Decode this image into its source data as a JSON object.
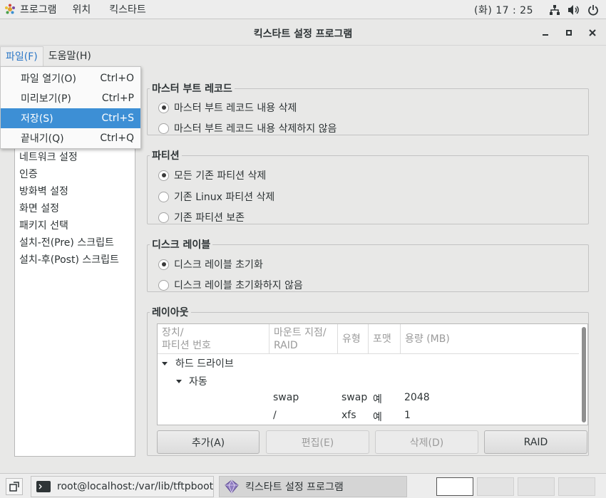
{
  "toppanel": {
    "apps_label": "프로그램",
    "places_label": "위치",
    "app_label": "킥스타트",
    "clock": "(화) 17 : 25"
  },
  "window": {
    "title": "킥스타트 설정 프로그램"
  },
  "menubar": {
    "file": "파일(F)",
    "help": "도움말(H)"
  },
  "file_menu": {
    "items": [
      {
        "label": "파일 열기(O)",
        "shortcut": "Ctrl+O"
      },
      {
        "label": "미리보기(P)",
        "shortcut": "Ctrl+P"
      },
      {
        "label": "저장(S)",
        "shortcut": "Ctrl+S"
      },
      {
        "label": "끝내기(Q)",
        "shortcut": "Ctrl+Q"
      }
    ]
  },
  "sidebar": {
    "items": [
      {
        "label": "네트워크 설정"
      },
      {
        "label": "인증"
      },
      {
        "label": "방화벽 설정"
      },
      {
        "label": "화면 설정"
      },
      {
        "label": "패키지 선택"
      },
      {
        "label": "설치-전(Pre) 스크립트"
      },
      {
        "label": "설치-후(Post) 스크립트"
      }
    ]
  },
  "mbr": {
    "title": "마스터 부트 레코드",
    "options": [
      "마스터 부트 레코드 내용 삭제",
      "마스터 부트 레코드 내용 삭제하지 않음"
    ],
    "selected_index": 0
  },
  "partition": {
    "title": "파티션",
    "options": [
      "모든 기존 파티션 삭제",
      "기존 Linux 파티션 삭제",
      "기존 파티션 보존"
    ],
    "selected_index": 0
  },
  "disklabel": {
    "title": "디스크 레이블",
    "options": [
      "디스크 레이블 초기화",
      "디스크 레이블 초기화하지 않음"
    ],
    "selected_index": 0
  },
  "layout": {
    "title": "레이아웃",
    "headers": [
      "장치/\n파티션 번호",
      "마운트 지점/\nRAID",
      "유형",
      "포맷",
      "용량 (MB)"
    ],
    "tree_root": "하드 드라이브",
    "tree_child": "자동",
    "rows": [
      {
        "mount": "swap",
        "type": "swap",
        "format": "예",
        "size": "2048"
      },
      {
        "mount": "/",
        "type": "xfs",
        "format": "예",
        "size": "1"
      }
    ],
    "buttons": {
      "add": "추가(A)",
      "edit": "편집(E)",
      "delete": "삭제(D)",
      "raid": "RAID"
    }
  },
  "taskbar": {
    "terminal_task": "root@localhost:/var/lib/tftpboot/px…",
    "kickstart_task": "킥스타트 설정 프로그램"
  },
  "colors": {
    "accent": "#3d8fd5",
    "menu_active_text": "#2a76c6"
  }
}
